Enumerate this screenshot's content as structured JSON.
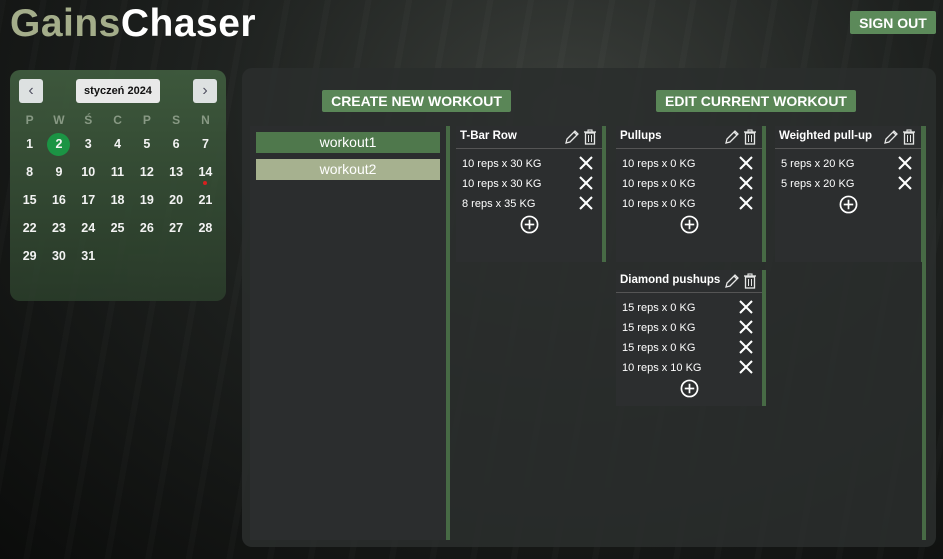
{
  "app": {
    "logo_part1": "Gains",
    "logo_part2": "Chaser",
    "signout_label": "SIGN OUT"
  },
  "calendar": {
    "month_label": "styczeń 2024",
    "prev": "‹",
    "next": "›",
    "weekdays": [
      "P",
      "W",
      "Ś",
      "C",
      "P",
      "S",
      "N"
    ],
    "days": [
      "1",
      "2",
      "3",
      "4",
      "5",
      "6",
      "7",
      "8",
      "9",
      "10",
      "11",
      "12",
      "13",
      "14",
      "15",
      "16",
      "17",
      "18",
      "19",
      "20",
      "21",
      "22",
      "23",
      "24",
      "25",
      "26",
      "27",
      "28",
      "29",
      "30",
      "31"
    ],
    "today": "2",
    "marked": "14",
    "marker_color": "#e12020"
  },
  "actions": {
    "create_label": "CREATE NEW WORKOUT",
    "edit_label": "EDIT CURRENT WORKOUT"
  },
  "workouts": [
    "workout1",
    "workout2"
  ],
  "exercises": [
    {
      "name": "T-Bar Row",
      "sets": [
        "10 reps x 30 KG",
        "10 reps x 30 KG",
        "8 reps x 35 KG"
      ]
    },
    {
      "name": "Pullups",
      "sets": [
        "10 reps x 0 KG",
        "10 reps x 0 KG",
        "10 reps x 0 KG"
      ]
    },
    {
      "name": "Weighted pull-up",
      "sets": [
        "5 reps x 20 KG",
        "5 reps x 20 KG"
      ]
    },
    {
      "name": "Diamond pushups",
      "sets": [
        "15 reps x 0 KG",
        "15 reps x 0 KG",
        "15 reps x 0 KG",
        "10 reps x 10 KG"
      ]
    }
  ],
  "icons": {
    "edit": "pencil-icon",
    "delete": "trash-icon",
    "remove_set": "close-icon",
    "add_set": "plus-circle-icon"
  },
  "colors": {
    "accent": "#5a8657",
    "today": "#1c9b47",
    "logo_muted": "#a4ad8a"
  }
}
